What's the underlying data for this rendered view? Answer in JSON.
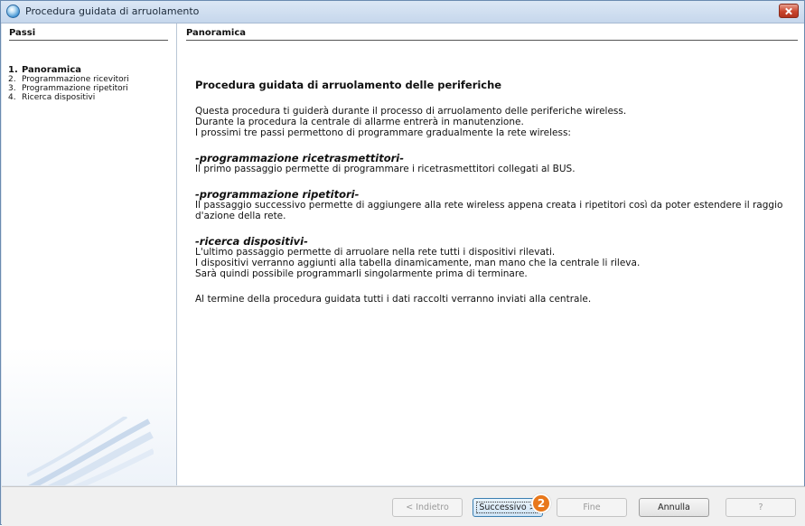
{
  "window": {
    "title": "Procedura guidata di arruolamento"
  },
  "sidebar": {
    "header": "Passi",
    "steps": [
      {
        "num": "1.",
        "label": "Panoramica",
        "active": true
      },
      {
        "num": "2.",
        "label": "Programmazione ricevitori",
        "active": false
      },
      {
        "num": "3.",
        "label": "Programmazione ripetitori",
        "active": false
      },
      {
        "num": "4.",
        "label": "Ricerca dispositivi",
        "active": false
      }
    ]
  },
  "main": {
    "header": "Panoramica",
    "heading": "Procedura guidata di arruolamento delle periferiche",
    "intro": [
      "Questa procedura ti guiderà durante il processo di arruolamento delle periferiche wireless.",
      "Durante la procedura la centrale di allarme entrerà in manutenzione.",
      "I prossimi tre passi permettono di programmare gradualmente la rete wireless:"
    ],
    "sections": [
      {
        "title": "-programmazione ricetrasmettitori-",
        "lines": [
          "Il primo passaggio permette di programmare i ricetrasmettitori collegati al BUS."
        ]
      },
      {
        "title": "-programmazione ripetitori-",
        "lines": [
          "Il passaggio successivo permette di aggiungere alla rete wireless appena creata i ripetitori così da poter estendere il raggio d'azione della rete."
        ]
      },
      {
        "title": "-ricerca dispositivi-",
        "lines": [
          "L'ultimo passaggio permette di arruolare nella rete tutti i dispositivi rilevati.",
          "I dispositivi verranno aggiunti alla tabella dinamicamente, man mano che la centrale li rileva.",
          "Sarà quindi possibile programmarli singolarmente prima di terminare."
        ]
      }
    ],
    "closing": "Al termine della procedura guidata tutti i dati raccolti verranno inviati alla centrale."
  },
  "buttons": {
    "back": "< Indietro",
    "next": "Successivo >",
    "finish": "Fine",
    "cancel": "Annulla",
    "help": "?"
  },
  "badge": {
    "text": "2",
    "color": "#e8781c"
  },
  "icons": {
    "app": "app-globe-icon",
    "close": "close-icon",
    "decoration": "wave-decoration"
  }
}
